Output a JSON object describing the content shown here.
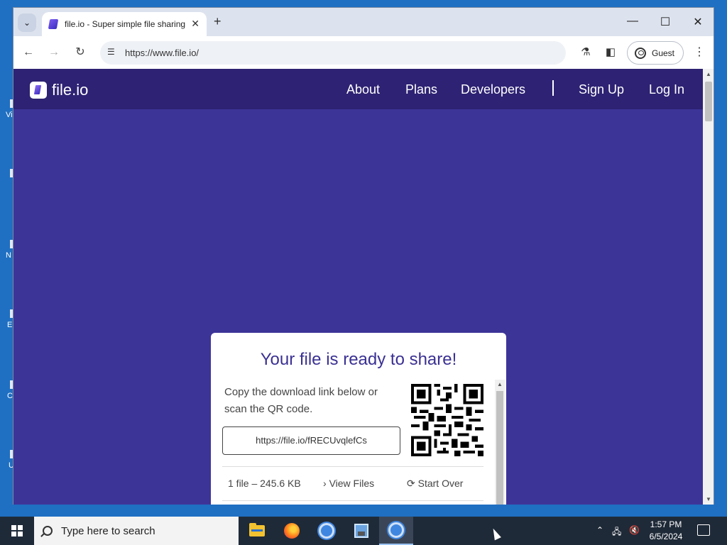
{
  "desktop": {
    "icons": [
      {
        "label": "Vi"
      },
      {
        "label": ""
      },
      {
        "label": "N"
      },
      {
        "label": "E"
      },
      {
        "label": "C"
      },
      {
        "label": "U"
      }
    ]
  },
  "browser": {
    "tab": {
      "title": "file.io - Super simple file sharing"
    },
    "new_tab_symbol": "+",
    "window_controls": {
      "minimize": "—",
      "maximize": "☐",
      "close": "✕"
    },
    "address": {
      "url": "https://www.file.io/"
    },
    "profile": {
      "label": "Guest"
    },
    "menu_symbol": "⋮"
  },
  "site": {
    "logo_text": "file.io",
    "nav": {
      "about": "About",
      "plans": "Plans",
      "developers": "Developers",
      "signup": "Sign Up",
      "login": "Log In"
    },
    "share_card": {
      "heading": "Your file is ready to share!",
      "description": "Copy the download link below or scan the QR code.",
      "link": "https://file.io/fRECUvqlefCs",
      "file_info": "1 file – 245.6 KB",
      "view_files": "View Files",
      "start_over": "Start Over"
    }
  },
  "taskbar": {
    "search_placeholder": "Type here to search",
    "time": "1:57 PM",
    "date": "6/5/2024"
  },
  "colors": {
    "page_bg": "#3d3498",
    "site_nav_bg": "#2d2273",
    "heading": "#3a3193",
    "desktop_bg": "#1f6fc2",
    "taskbar_bg": "#1f2a38"
  }
}
